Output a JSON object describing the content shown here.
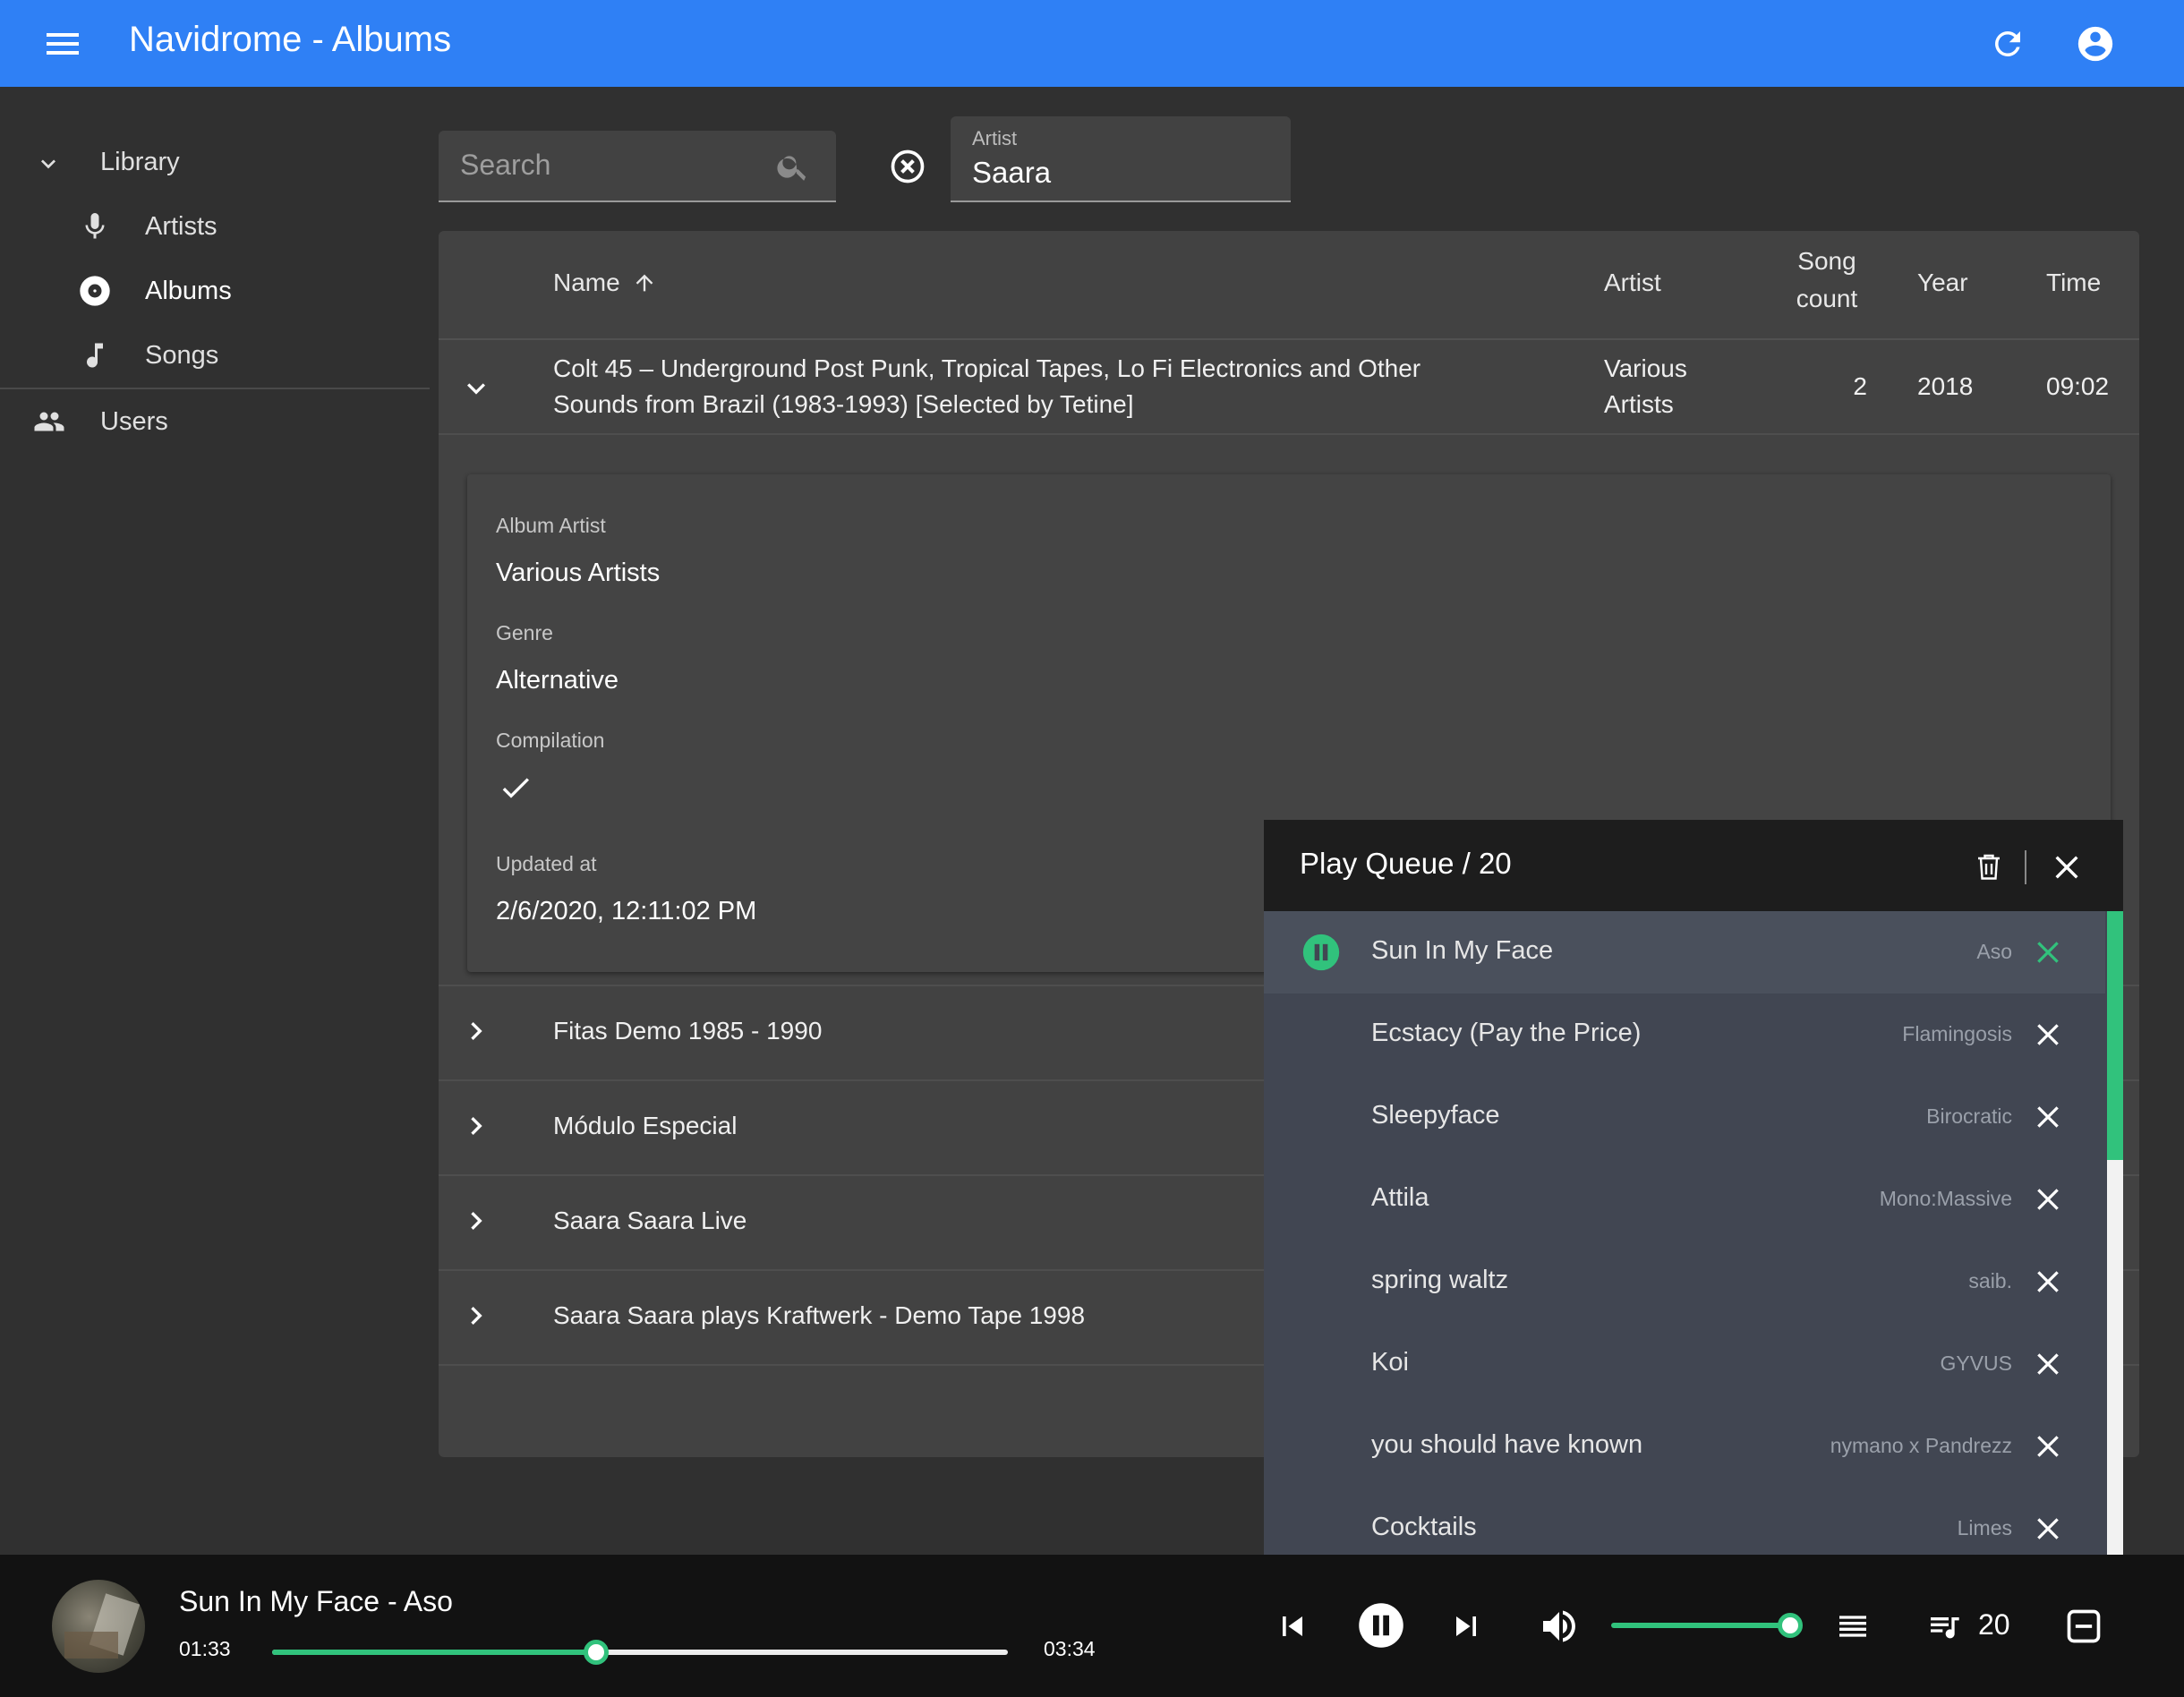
{
  "appbar": {
    "title": "Navidrome - Albums"
  },
  "sidebar": {
    "library": "Library",
    "items": [
      {
        "label": "Artists",
        "icon": "microphone-icon"
      },
      {
        "label": "Albums",
        "icon": "album-disc-icon"
      },
      {
        "label": "Songs",
        "icon": "music-note-icon"
      }
    ],
    "users": "Users"
  },
  "filters": {
    "search_placeholder": "Search",
    "artist_label": "Artist",
    "artist_value": "Saara"
  },
  "table": {
    "headers": {
      "name": "Name",
      "artist": "Artist",
      "song_count_1": "Song",
      "song_count_2": "count",
      "year": "Year",
      "time": "Time"
    },
    "expanded_row": {
      "name_line1": "Colt 45 – Underground Post Punk, Tropical Tapes, Lo Fi Electronics and Other",
      "name_line2": "Sounds from Brazil (1983-1993) [Selected by Tetine]",
      "artist_line1": "Various",
      "artist_line2": "Artists",
      "song_count": "2",
      "year": "2018",
      "time": "09:02"
    },
    "details": {
      "album_artist_label": "Album Artist",
      "album_artist": "Various Artists",
      "genre_label": "Genre",
      "genre": "Alternative",
      "compilation_label": "Compilation",
      "updated_label": "Updated at",
      "updated": "2/6/2020, 12:11:02 PM"
    },
    "rows": [
      {
        "name": "Fitas Demo 1985 - 1990"
      },
      {
        "name": "Módulo Especial"
      },
      {
        "name": "Saara Saara Live"
      },
      {
        "name": "Saara Saara plays Kraftwerk - Demo Tape 1998"
      }
    ]
  },
  "queue": {
    "title": "Play Queue / 20",
    "items": [
      {
        "name": "Sun In My Face",
        "artist": "Aso"
      },
      {
        "name": "Ecstacy (Pay the Price)",
        "artist": "Flamingosis"
      },
      {
        "name": "Sleepyface",
        "artist": "Birocratic"
      },
      {
        "name": "Attila",
        "artist": "Mono:Massive"
      },
      {
        "name": "spring waltz",
        "artist": "saib."
      },
      {
        "name": "Koi",
        "artist": "GYVUS"
      },
      {
        "name": "you should have known",
        "artist": "nymano x Pandrezz"
      },
      {
        "name": "Cocktails",
        "artist": "Limes"
      }
    ]
  },
  "player": {
    "now_playing": "Sun In My Face - Aso",
    "current_time": "01:33",
    "total_time": "03:34",
    "progress": 0.44,
    "volume": 1.0,
    "queue_count": "20"
  },
  "colors": {
    "accent": "#2f80f5",
    "playing": "#31c27c"
  }
}
